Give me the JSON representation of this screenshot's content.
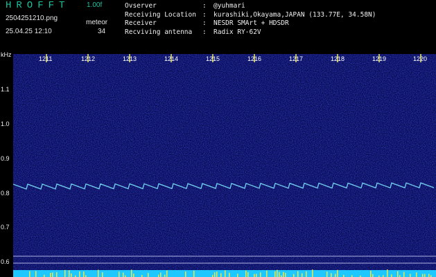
{
  "header": {
    "app_name": "HROFFT",
    "version": "1.00f",
    "file_name": "2504251210.png",
    "datetime": "25.04.25 12:10",
    "meteor_label": "meteor",
    "meteor_count": "34"
  },
  "station": [
    {
      "key": "Ovserver",
      "value": "@yuhmari"
    },
    {
      "key": "Receiving Location",
      "value": "kurashiki,Okayama,JAPAN (133.77E, 34.58N)"
    },
    {
      "key": "Receiver",
      "value": "NESDR SMArt + HDSDR"
    },
    {
      "key": "Recviving antenna",
      "value": "Radix RY-62V"
    }
  ],
  "axis": {
    "y_unit": "kHz",
    "y_ticks": [
      "1.1",
      "1.0",
      "0.9",
      "0.8",
      "0.7",
      "0.6"
    ],
    "x_ticks": [
      "1211",
      "1212",
      "1213",
      "1214",
      "1215",
      "1216",
      "1217",
      "1218",
      "1219",
      "1220"
    ]
  },
  "colors": {
    "background": "#000000",
    "spectrogram_base": "#0a0f6e",
    "trace": "#7fe8ff",
    "accent": "#19c39e",
    "bottom_band": "#1ec8ff",
    "bottom_spikes": "#e8e84a"
  }
}
